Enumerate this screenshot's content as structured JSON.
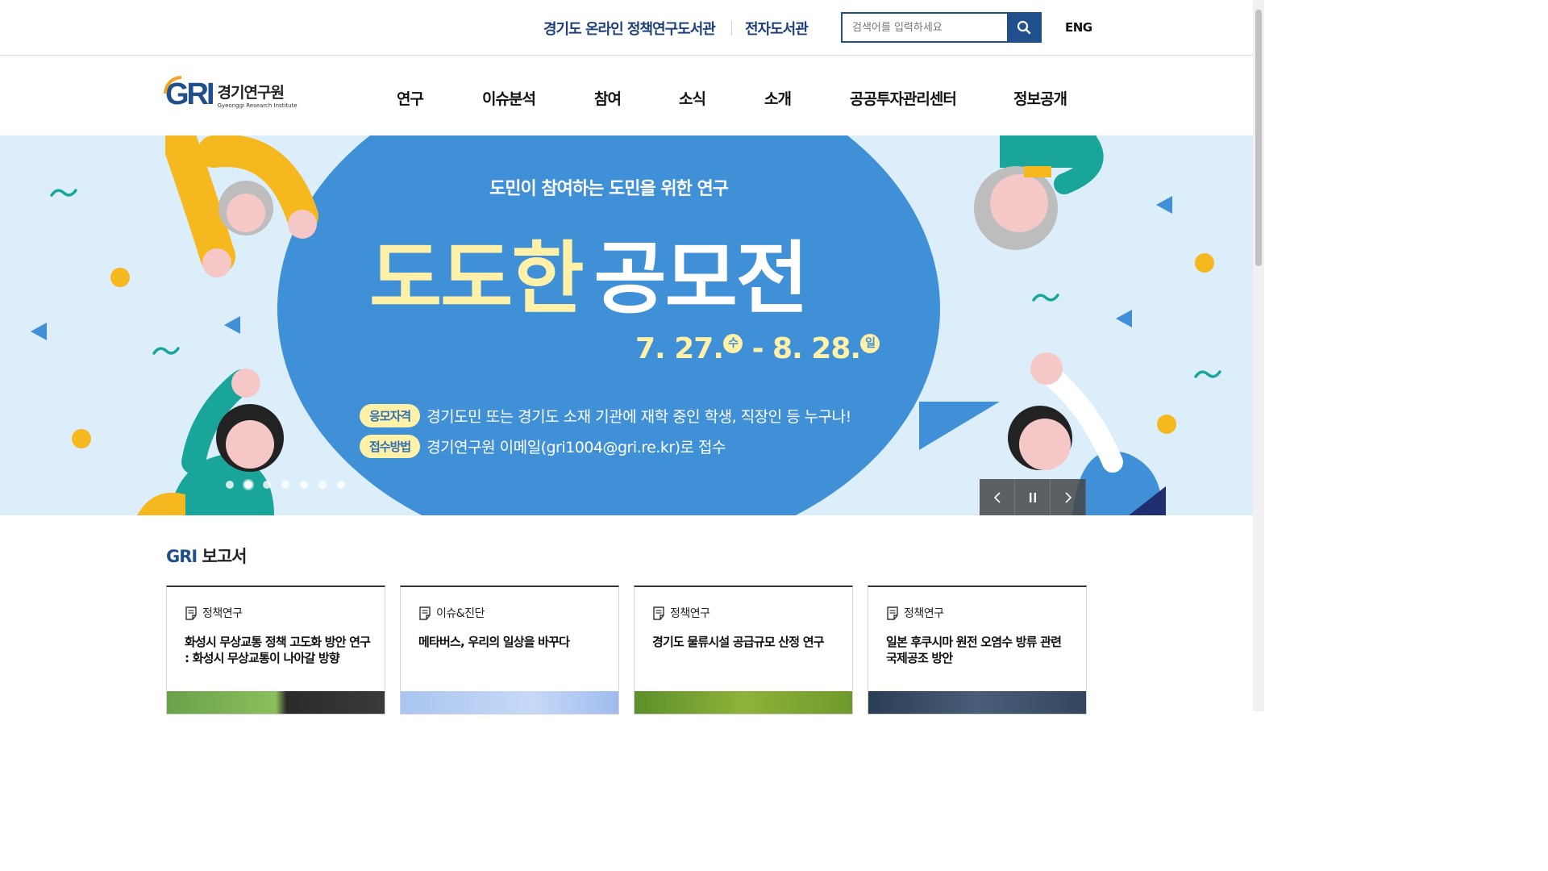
{
  "topbar": {
    "library_link": "경기도 온라인 정책연구도서관",
    "ebook_link": "전자도서관",
    "search_placeholder": "검색어를 입력하세요",
    "lang_link": "ENG"
  },
  "logo": {
    "mark": "GRI",
    "name_kr": "경기연구원",
    "name_en": "Gyeonggi Research Institute"
  },
  "nav": {
    "items": [
      "연구",
      "이슈분석",
      "참여",
      "소식",
      "소개",
      "공공투자관리센터",
      "정보공개"
    ]
  },
  "hero": {
    "subtitle": "도민이 참여하는 도민을 위한 연구",
    "title_part1": "도도한",
    "title_part2": "공모전",
    "date_start": "7. 27.",
    "date_start_day": "수",
    "date_sep": " - ",
    "date_end": "8. 28.",
    "date_end_day": "일",
    "eligibility_label": "응모자격",
    "eligibility_text": "경기도민 또는 경기도 소재 기관에 재학 중인 학생, 직장인 등 누구나!",
    "submit_label": "접수방법",
    "submit_text": "경기연구원 이메일(gri1004@gri.re.kr)로 접수",
    "slide_count": 7,
    "active_slide": 2,
    "colors": {
      "background": "#dceefa",
      "bubble": "#3f90d6",
      "highlight": "#fff1a8",
      "accent": "#f5b81f"
    }
  },
  "reports": {
    "title_en": "GRI",
    "title_kr": "보고서",
    "cards": [
      {
        "category": "정책연구",
        "title": "화성시 무상교통 정책 고도화 방안 연구 : 화성시 무상교통이 나아갈 방향"
      },
      {
        "category": "이슈&진단",
        "title": "메타버스, 우리의 일상을 바꾸다"
      },
      {
        "category": "정책연구",
        "title": "경기도 물류시설 공급규모 산정 연구"
      },
      {
        "category": "정책연구",
        "title": "일본 후쿠시마 원전 오염수 방류 관련 국제공조 방안"
      }
    ]
  },
  "icons": {
    "search": "search-icon",
    "prev": "chevron-left-icon",
    "pause": "pause-icon",
    "next": "chevron-right-icon",
    "document": "document-icon"
  },
  "brand_color": "#1f4f8c"
}
